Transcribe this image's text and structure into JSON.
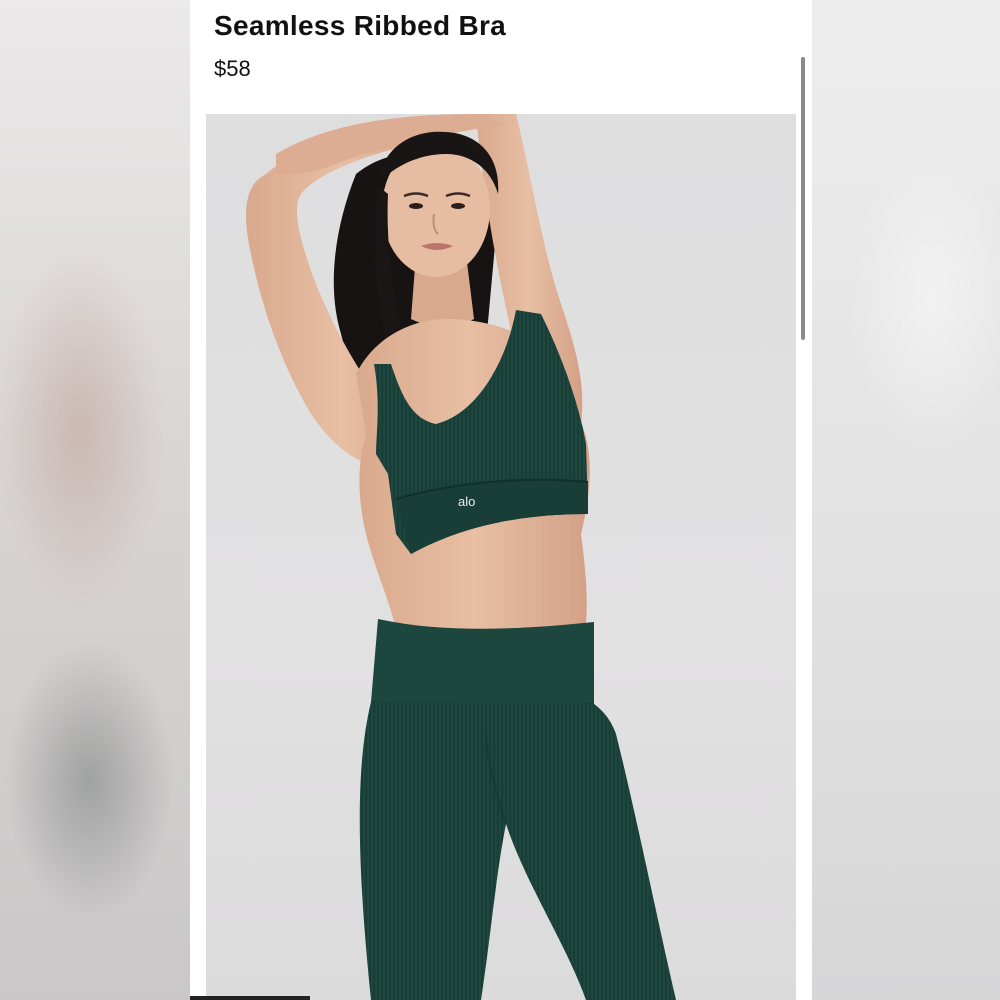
{
  "product": {
    "title": "Seamless Ribbed Bra",
    "price": "$58",
    "brand_logo": "alo",
    "garment_color": "#1f4a42",
    "photo_background": "#e0dfe0"
  }
}
